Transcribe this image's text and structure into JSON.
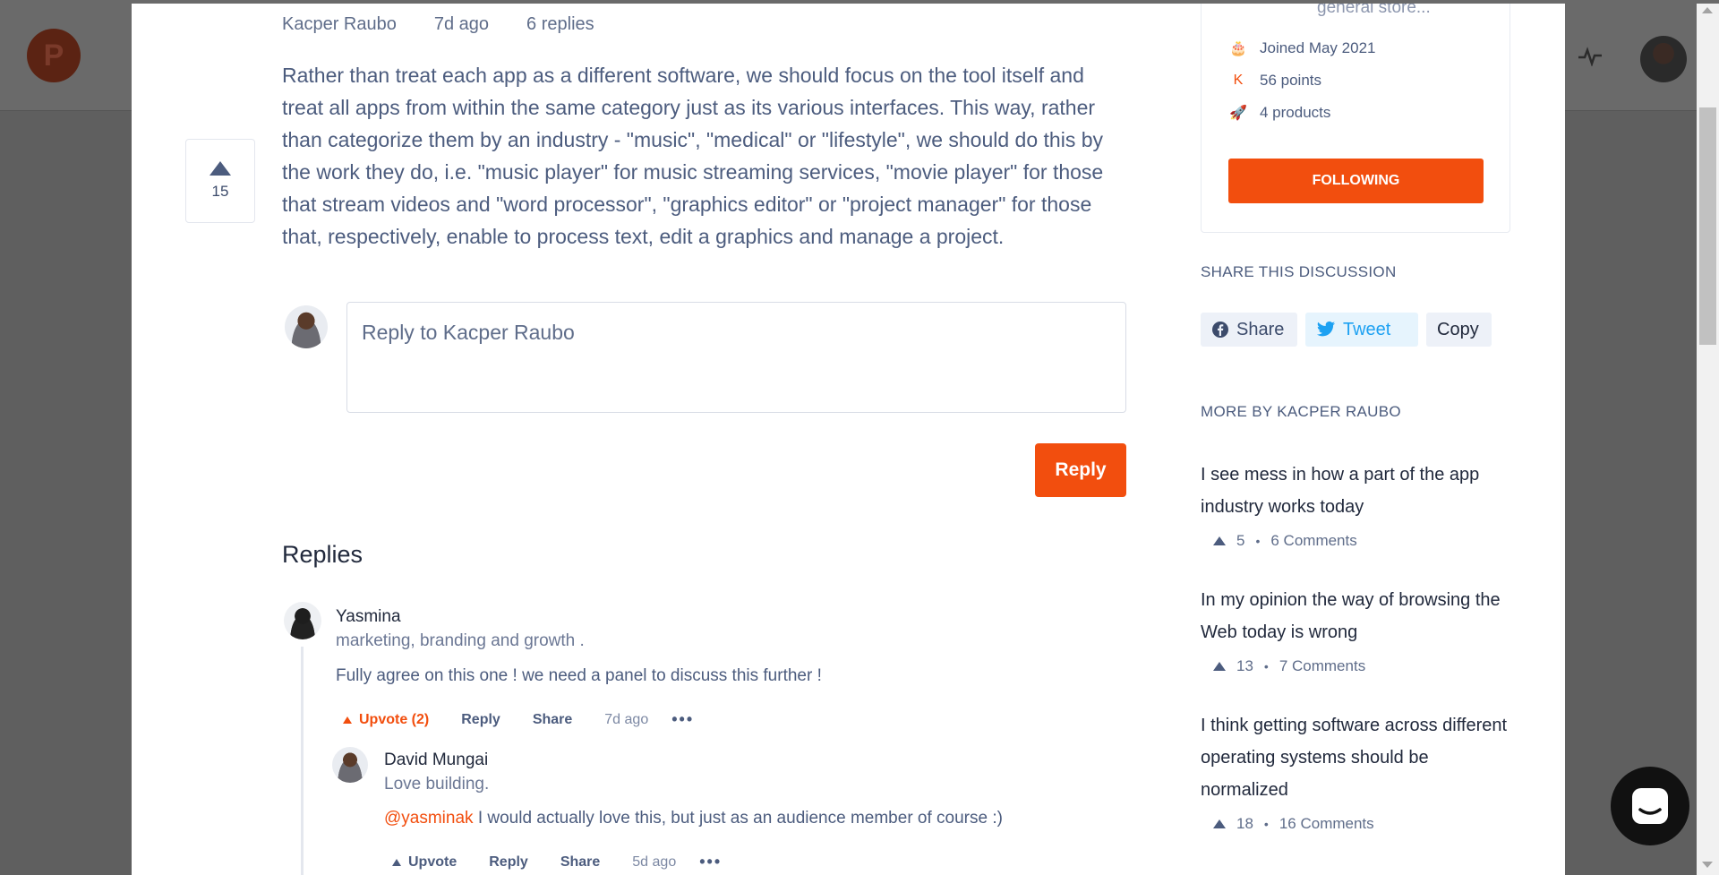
{
  "colors": {
    "accent": "#f24e0e",
    "text_dark": "#21293c",
    "text": "#4c5c7e"
  },
  "post": {
    "author": "Kacper Raubo",
    "age": "7d ago",
    "replies_count": "6 replies",
    "votes": "15",
    "body": "Rather than treat each app as a different software, we should focus on the tool itself and treat all apps from within the same category just as its various interfaces. This way, rather than categorize them by an industry - \"music\", \"medical\" or \"lifestyle\", we should do this by the work they do, i.e. \"music player\" for music streaming services, \"movie player\" for those that stream videos and \"word processor\", \"graphics editor\" or \"project manager\" for those that, respectively, enable to process text, edit a graphics and manage a project."
  },
  "reply_form": {
    "placeholder": "Reply to Kacper Raubo",
    "submit_label": "Reply"
  },
  "replies": {
    "heading": "Replies",
    "items": [
      {
        "name": "Yasmina",
        "headline": "marketing, branding and growth .",
        "text": "Fully agree on this one ! we need a panel to discuss this further !",
        "upvote": "Upvote (2)",
        "reply": "Reply",
        "share": "Share",
        "time": "7d ago",
        "more": "•••"
      },
      {
        "name": "David Mungai",
        "headline": "Love building.",
        "mention": "@yasminak",
        "text": " I would actually love this, but just as an audience member of course :)",
        "upvote": "Upvote",
        "reply": "Reply",
        "share": "Share",
        "time": "5d ago",
        "more": "•••"
      }
    ]
  },
  "sidebar": {
    "store_text": "general store...",
    "stats": [
      {
        "icon": "cake-icon",
        "glyph": "🎂",
        "text": "Joined May 2021"
      },
      {
        "icon": "points-icon",
        "glyph": "K",
        "text": "56 points"
      },
      {
        "icon": "rocket-icon",
        "glyph": "🚀",
        "text": "4 products"
      }
    ],
    "follow_label": "FOLLOWING",
    "share_heading": "SHARE THIS DISCUSSION",
    "share": {
      "facebook": "Share",
      "twitter": "Tweet",
      "copy": "Copy"
    },
    "more_heading": "MORE BY KACPER RAUBO",
    "more": [
      {
        "title": "I see mess in how a part of the app industry works today",
        "votes": "5",
        "comments": "6 Comments"
      },
      {
        "title": "In my opinion the way of browsing the Web today is wrong",
        "votes": "13",
        "comments": "7 Comments"
      },
      {
        "title": "I think getting software across different operating systems should be normalized",
        "votes": "18",
        "comments": "16 Comments"
      }
    ]
  },
  "background": {
    "logo_letter": "P"
  }
}
